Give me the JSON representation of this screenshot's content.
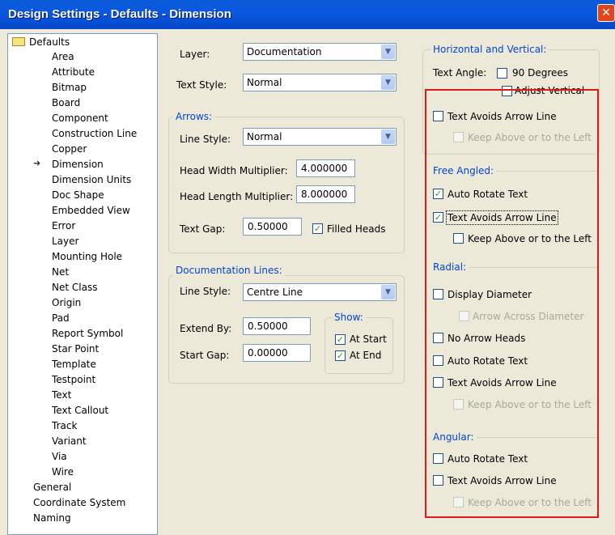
{
  "window": {
    "title": "Design Settings - Defaults - Dimension",
    "close_glyph": "✕"
  },
  "tree": {
    "root": "Defaults",
    "items": [
      "Area",
      "Attribute",
      "Bitmap",
      "Board",
      "Component",
      "Construction Line",
      "Copper",
      "Dimension",
      "Dimension Units",
      "Doc Shape",
      "Embedded View",
      "Error",
      "Layer",
      "Mounting Hole",
      "Net",
      "Net Class",
      "Origin",
      "Pad",
      "Report Symbol",
      "Star Point",
      "Template",
      "Testpoint",
      "Text",
      "Text Callout",
      "Track",
      "Variant",
      "Via",
      "Wire"
    ],
    "selected": "Dimension",
    "top_items": [
      "General",
      "Coordinate System",
      "Naming"
    ]
  },
  "form": {
    "layer_label": "Layer:",
    "layer_value": "Documentation",
    "text_style_label": "Text Style:",
    "text_style_value": "Normal",
    "arrows": {
      "title": "Arrows:",
      "line_style_label": "Line Style:",
      "line_style_value": "Normal",
      "head_width_label": "Head Width Multiplier:",
      "head_width_value": "4.000000",
      "head_length_label": "Head Length Multiplier:",
      "head_length_value": "8.000000",
      "text_gap_label": "Text Gap:",
      "text_gap_value": "0.50000",
      "filled_heads_label": "Filled Heads",
      "filled_heads_checked": true
    },
    "doc_lines": {
      "title": "Documentation Lines:",
      "line_style_label": "Line Style:",
      "line_style_value": "Centre Line",
      "extend_by_label": "Extend By:",
      "extend_by_value": "0.50000",
      "start_gap_label": "Start Gap:",
      "start_gap_value": "0.00000",
      "show_title": "Show:",
      "at_start_label": "At Start",
      "at_start_checked": true,
      "at_end_label": "At End",
      "at_end_checked": true
    }
  },
  "right": {
    "hv": {
      "title": "Horizontal and Vertical:",
      "text_angle_label": "Text Angle:",
      "deg90_label": "90 Degrees",
      "adjust_vertical_label": "Adjust Vertical",
      "avoid_label": "Text Avoids Arrow Line",
      "keep_label": "Keep Above or to the Left"
    },
    "free": {
      "title": "Free Angled:",
      "auto_rotate_label": "Auto Rotate Text",
      "auto_rotate_checked": true,
      "avoid_label": "Text Avoids Arrow Line",
      "avoid_checked": true,
      "keep_label": "Keep Above or to the Left"
    },
    "radial": {
      "title": "Radial:",
      "display_diameter_label": "Display Diameter",
      "arrow_across_label": "Arrow Across Diameter",
      "no_arrow_heads_label": "No Arrow Heads",
      "auto_rotate_label": "Auto Rotate Text",
      "avoid_label": "Text Avoids Arrow Line",
      "keep_label": "Keep Above or to the Left"
    },
    "angular": {
      "title": "Angular:",
      "auto_rotate_label": "Auto Rotate Text",
      "avoid_label": "Text Avoids Arrow Line",
      "keep_label": "Keep Above or to the Left"
    }
  },
  "colors": {
    "highlight": "#e01818",
    "group_title": "#0046d5",
    "titlebar": "#0a5bd8"
  },
  "icons": {
    "dropdown": "chevron-down-icon",
    "check": "checkmark-icon",
    "folder": "folder-icon",
    "selected_arrow": "arrow-right-icon"
  }
}
